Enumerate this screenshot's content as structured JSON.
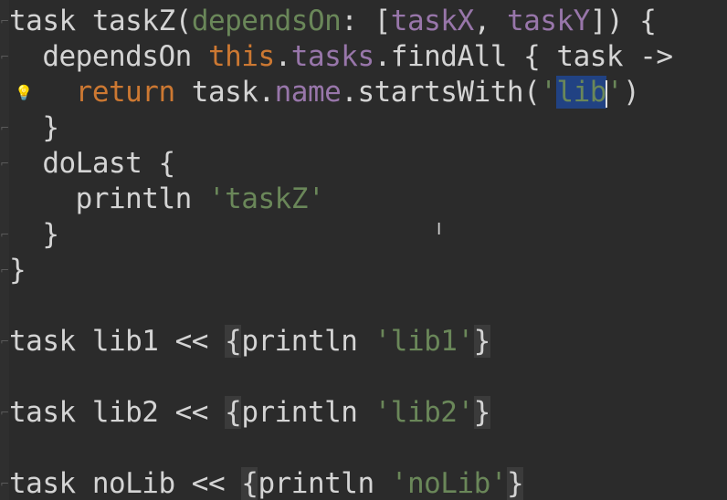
{
  "colors": {
    "background": "#2b2b2b",
    "keyword": "#cc7832",
    "string": "#6a8759",
    "property": "#9876aa",
    "selection": "#214283",
    "text": "#d4d4d4"
  },
  "icons": {
    "gutter_bulb": "lightbulb-icon",
    "mouse_cursor": "text-cursor-icon"
  },
  "code": {
    "l1": {
      "a": "task taskZ(",
      "b": "dependsOn",
      "c": ": [",
      "d": "taskX",
      "e": ", ",
      "f": "taskY",
      "g": "]) {"
    },
    "l2": {
      "a": "  dependsOn ",
      "b": "this",
      "c": ".",
      "d": "tasks",
      "e": ".findAll { task ->"
    },
    "l3": {
      "a": "    ",
      "b": "return",
      "c": " task.",
      "d": "name",
      "e": ".startsWith(",
      "f": "'",
      "g": "lib",
      "h": "'",
      "i": ")"
    },
    "l4": "  }",
    "l5": "  doLast {",
    "l6": {
      "a": "    println ",
      "b": "'taskZ'"
    },
    "l7": "  }",
    "l8": "}",
    "l10": {
      "a": "task lib1 << ",
      "b": "{",
      "c": "println ",
      "d": "'lib1'",
      "e": "}"
    },
    "l12": {
      "a": "task lib2 << ",
      "b": "{",
      "c": "println ",
      "d": "'lib2'",
      "e": "}"
    },
    "l14": {
      "a": "task noLib << ",
      "b": "{",
      "c": "println ",
      "d": "'noLib'",
      "e": "}"
    }
  }
}
